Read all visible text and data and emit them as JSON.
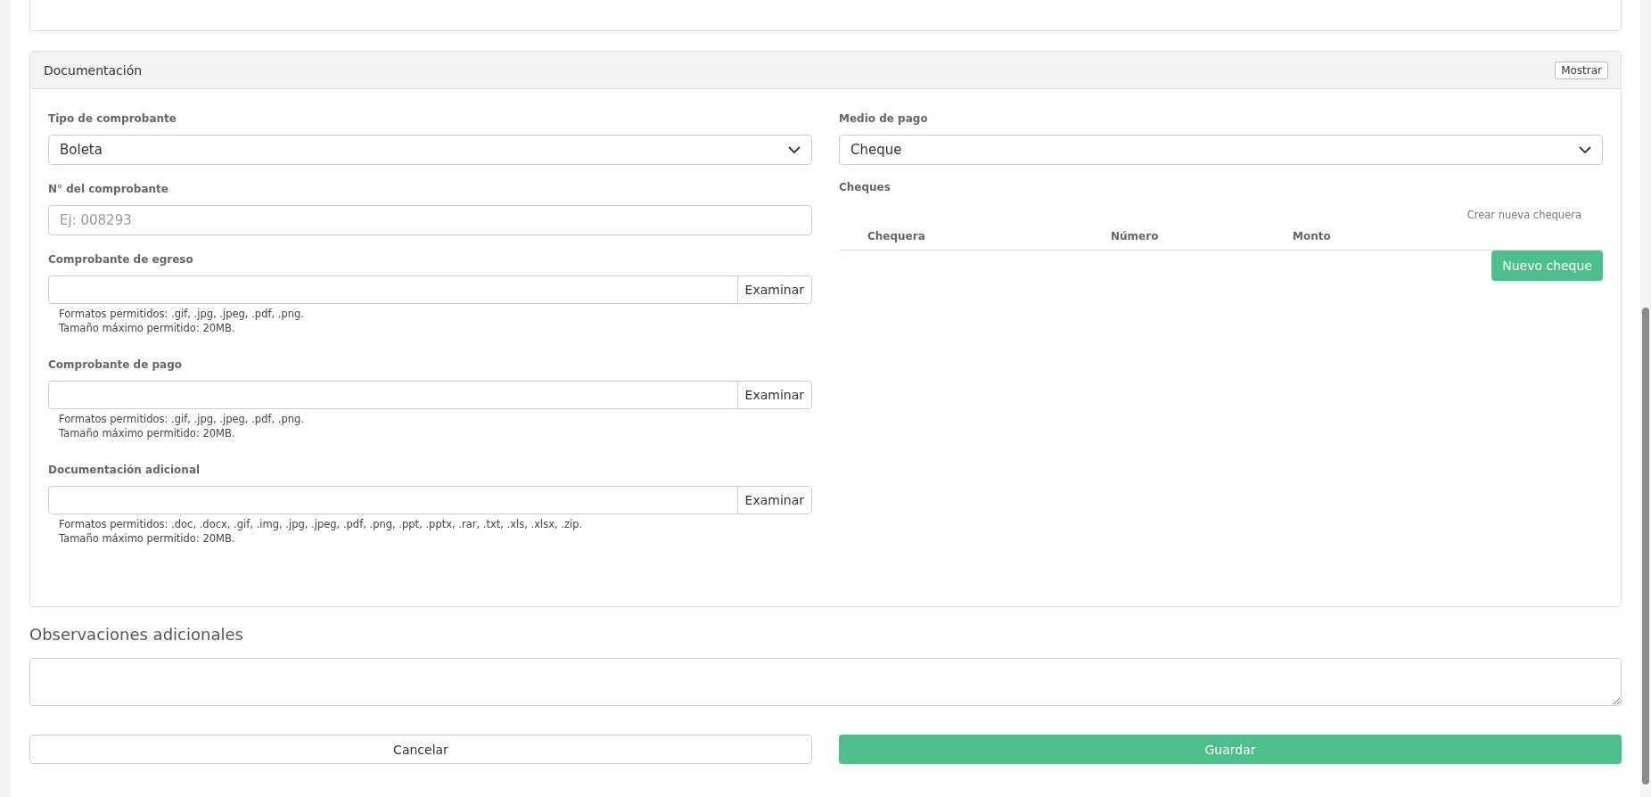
{
  "documentation": {
    "title": "Documentación",
    "toggle_button": "Mostrar",
    "left_fields": [
      {
        "kind": "select",
        "label": "Tipo de comprobante",
        "value": "Boleta"
      },
      {
        "kind": "text",
        "label": "N° del comprobante",
        "placeholder": "Ej: 008293"
      },
      {
        "kind": "file",
        "label": "Comprobante de egreso",
        "button": "Examinar",
        "help": [
          "Formatos permitidos: .gif, .jpg, .jpeg, .pdf, .png.",
          "Tamaño máximo permitido: 20MB."
        ]
      },
      {
        "kind": "file",
        "label": "Comprobante de pago",
        "button": "Examinar",
        "help": [
          "Formatos permitidos: .gif, .jpg, .jpeg, .pdf, .png.",
          "Tamaño máximo permitido: 20MB."
        ]
      },
      {
        "kind": "file",
        "label": "Documentación adicional",
        "button": "Examinar",
        "help": [
          "Formatos permitidos: .doc, .docx, .gif, .img, .jpg, .jpeg, .pdf, .png, .ppt, .pptx, .rar, .txt, .xls, .xlsx, .zip.",
          "Tamaño máximo permitido: 20MB."
        ]
      }
    ],
    "payment": {
      "label": "Medio de pago",
      "value": "Cheque"
    },
    "cheques": {
      "label": "Cheques",
      "create_link": "Crear nueva chequera",
      "columns": [
        "Chequera",
        "Número",
        "Monto"
      ],
      "add_button": "Nuevo cheque"
    }
  },
  "observations": {
    "title": "Observaciones adicionales"
  },
  "buttons": [
    {
      "kind": "cancel",
      "label": "Cancelar"
    },
    {
      "kind": "save",
      "label": "Guardar"
    }
  ]
}
